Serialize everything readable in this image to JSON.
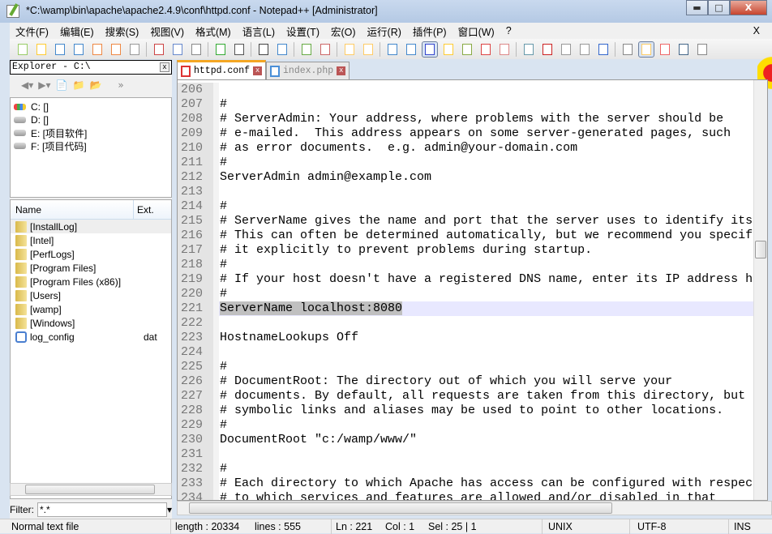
{
  "window": {
    "title": "*C:\\wamp\\bin\\apache\\apache2.4.9\\conf\\httpd.conf - Notepad++ [Administrator]",
    "buttons": [
      "minimize",
      "maximize",
      "close"
    ]
  },
  "menu": {
    "items": [
      "文件(F)",
      "编辑(E)",
      "搜索(S)",
      "视图(V)",
      "格式(M)",
      "语言(L)",
      "设置(T)",
      "宏(O)",
      "运行(R)",
      "插件(P)",
      "窗口(W)",
      "?"
    ],
    "close": "X"
  },
  "toolbar": {
    "icons": [
      "new",
      "open",
      "save",
      "save-all",
      "close",
      "close-all",
      "print",
      "cut",
      "copy",
      "paste",
      "undo",
      "redo",
      "find",
      "replace",
      "zoom-in",
      "zoom-out",
      "sync-v",
      "sync-h",
      "word-wrap",
      "show-all",
      "indent-guide",
      "udl",
      "doc-map",
      "function-list",
      "folder-workspace",
      "monitor",
      "record",
      "stop",
      "play",
      "play-multiple",
      "save-macro",
      "explorer",
      "favorites",
      "console",
      "spell"
    ]
  },
  "explorer": {
    "title": "Explorer - C:\\",
    "close": "x",
    "drives": [
      {
        "label": "C: []",
        "icon": "windows-drive"
      },
      {
        "label": "D: []",
        "icon": "drive"
      },
      {
        "label": "E: [项目软件]",
        "icon": "drive"
      },
      {
        "label": "F: [项目代码]",
        "icon": "drive"
      }
    ],
    "columns": {
      "name": "Name",
      "ext": "Ext."
    },
    "files": [
      {
        "name": "[InstallLog]",
        "ext": "",
        "type": "folder"
      },
      {
        "name": "[Intel]",
        "ext": "",
        "type": "folder"
      },
      {
        "name": "[PerfLogs]",
        "ext": "",
        "type": "folder"
      },
      {
        "name": "[Program Files]",
        "ext": "",
        "type": "folder"
      },
      {
        "name": "[Program Files (x86)]",
        "ext": "",
        "type": "folder"
      },
      {
        "name": "[Users]",
        "ext": "",
        "type": "folder"
      },
      {
        "name": "[wamp]",
        "ext": "",
        "type": "folder"
      },
      {
        "name": "[Windows]",
        "ext": "",
        "type": "folder"
      },
      {
        "name": "log_config",
        "ext": "dat",
        "type": "file"
      }
    ],
    "filter_label": "Filter:",
    "filter_value": "*.*"
  },
  "tabs": [
    {
      "label": "httpd.conf",
      "active": true
    },
    {
      "label": "index.php",
      "active": false
    }
  ],
  "editor": {
    "current_line": 221,
    "selection": "ServerName localhost:8080",
    "lines": [
      {
        "n": "206",
        "t": ""
      },
      {
        "n": "207",
        "t": "#"
      },
      {
        "n": "208",
        "t": "# ServerAdmin: Your address, where problems with the server should be"
      },
      {
        "n": "209",
        "t": "# e-mailed.  This address appears on some server-generated pages, such"
      },
      {
        "n": "210",
        "t": "# as error documents.  e.g. admin@your-domain.com"
      },
      {
        "n": "211",
        "t": "#"
      },
      {
        "n": "212",
        "t": "ServerAdmin admin@example.com"
      },
      {
        "n": "213",
        "t": ""
      },
      {
        "n": "214",
        "t": "#"
      },
      {
        "n": "215",
        "t": "# ServerName gives the name and port that the server uses to identify itse"
      },
      {
        "n": "216",
        "t": "# This can often be determined automatically, but we recommend you specif"
      },
      {
        "n": "217",
        "t": "# it explicitly to prevent problems during startup."
      },
      {
        "n": "218",
        "t": "#"
      },
      {
        "n": "219",
        "t": "# If your host doesn't have a registered DNS name, enter its IP address ho"
      },
      {
        "n": "220",
        "t": "#"
      },
      {
        "n": "221",
        "t": "ServerName localhost:8080"
      },
      {
        "n": "222",
        "t": ""
      },
      {
        "n": "223",
        "t": "HostnameLookups Off"
      },
      {
        "n": "224",
        "t": ""
      },
      {
        "n": "225",
        "t": "#"
      },
      {
        "n": "226",
        "t": "# DocumentRoot: The directory out of which you will serve your"
      },
      {
        "n": "227",
        "t": "# documents. By default, all requests are taken from this directory, but"
      },
      {
        "n": "228",
        "t": "# symbolic links and aliases may be used to point to other locations."
      },
      {
        "n": "229",
        "t": "#"
      },
      {
        "n": "230",
        "t": "DocumentRoot \"c:/wamp/www/\""
      },
      {
        "n": "231",
        "t": ""
      },
      {
        "n": "232",
        "t": "#"
      },
      {
        "n": "233",
        "t": "# Each directory to which Apache has access can be configured with respec"
      },
      {
        "n": "234",
        "t": "# to which services and features are allowed and/or disabled in that"
      }
    ]
  },
  "status": {
    "type": "Normal text file",
    "length": "length : 20334",
    "lines": "lines : 555",
    "ln": "Ln : 221",
    "col": "Col : 1",
    "sel": "Sel : 25 | 1",
    "eol": "UNIX",
    "encoding": "UTF-8",
    "mode": "INS"
  }
}
